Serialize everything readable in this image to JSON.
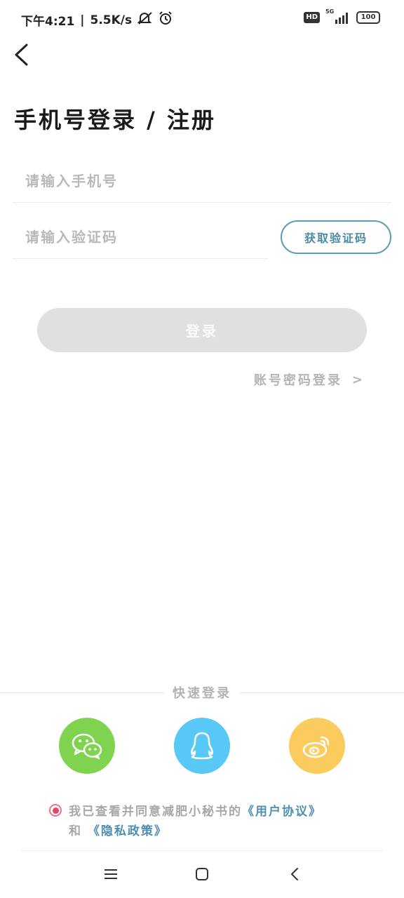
{
  "status_bar": {
    "time": "下午4:21",
    "separator": "|",
    "speed": "5.5K/s",
    "hd": "HD",
    "network": "5G",
    "battery": "100"
  },
  "title": "手机号登录 / 注册",
  "phone_input": {
    "placeholder": "请输入手机号"
  },
  "code_input": {
    "placeholder": "请输入验证码"
  },
  "get_code_label": "获取验证码",
  "login_label": "登录",
  "password_login": {
    "label": "账号密码登录",
    "arrow": ">"
  },
  "quick_login_title": "快速登录",
  "social": [
    "wechat-icon",
    "qq-icon",
    "weibo-icon"
  ],
  "agreement": {
    "text": "我已查看并同意减肥小秘书的",
    "user_agreement": "《用户协议》",
    "and": "和",
    "privacy_policy": "《隐私政策》"
  },
  "colors": {
    "accent": "#4f8fb0",
    "login_disabled": "#e0e0e0",
    "wechat": "#7fd34f",
    "qq": "#58c8f6",
    "weibo": "#fccb5e",
    "radio": "#e9456b"
  }
}
